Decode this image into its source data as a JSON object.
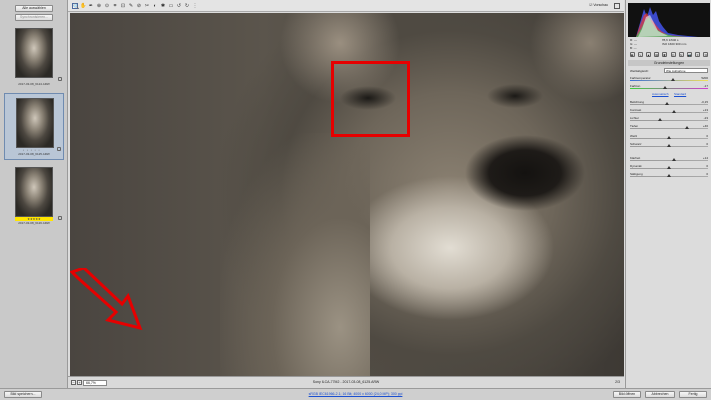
{
  "filmstrip": {
    "select_all_label": "Alle auswählen",
    "synchronize_label": "Synchronisieren...",
    "thumbnails": [
      {
        "caption": "2017-03-08_6124.ARW"
      },
      {
        "caption": "2017-03-08_6125.ARW",
        "dots": "• • • • •"
      },
      {
        "caption": "2017-03-08_6126.ARW",
        "stars": "★★★★★"
      }
    ]
  },
  "toolbar": {
    "tools": [
      "🔍",
      "✋",
      "✒",
      "⊕",
      "⊙",
      "⌗",
      "⊡",
      "✎",
      "⊘",
      "✂",
      "◐",
      "✱",
      "▭",
      "↺",
      "↻",
      "⋮"
    ],
    "preview_label": "Vorschau"
  },
  "canvas": {
    "zoom_value": "66,7%",
    "file_label": "Sony ILCA-77M2 - 2017-03-08_6125.ARW",
    "nav_count": "2/3"
  },
  "panel": {
    "rgb_readout": [
      "R: ---",
      "G: ---",
      "B: ---"
    ],
    "cam_info": [
      "f/5,6   1/640 s",
      "ISO 1600   300 mm"
    ],
    "section_title": "Grundeinstellungen",
    "wb_label": "Weißabgleich:",
    "wb_value": "Wie Aufnahme",
    "auto_link": "Automatisch",
    "default_link": "Standard",
    "sliders": [
      {
        "label": "Farbtemperatur",
        "value": "5200",
        "pos": 0.55
      },
      {
        "label": "Farbton",
        "value": "-17",
        "pos": 0.45
      },
      {
        "label": "Belichtung",
        "value": "-0,15",
        "pos": 0.48
      },
      {
        "label": "Kontrast",
        "value": "+13",
        "pos": 0.56
      },
      {
        "label": "Lichter",
        "value": "-23",
        "pos": 0.38
      },
      {
        "label": "Tiefen",
        "value": "+46",
        "pos": 0.73
      },
      {
        "label": "Weiß",
        "value": "0",
        "pos": 0.5
      },
      {
        "label": "Schwarz",
        "value": "0",
        "pos": 0.5
      },
      {
        "label": "Klarheit",
        "value": "+14",
        "pos": 0.57
      },
      {
        "label": "Dynamik",
        "value": "0",
        "pos": 0.5
      },
      {
        "label": "Sättigung",
        "value": "0",
        "pos": 0.5
      }
    ]
  },
  "footer": {
    "save_label": "Bild speichern...",
    "workflow_link": "sRGB IEC61966-2.1; 16 Bit; 4000 x 6000 (24,0 MP); 300 ppi",
    "open_label": "Bild öffnen",
    "cancel_label": "Abbrechen",
    "done_label": "Fertig"
  },
  "colors": {
    "highlight_box": "#e60000",
    "accent_link": "#1a4fd1",
    "rating": "#ffe500"
  }
}
